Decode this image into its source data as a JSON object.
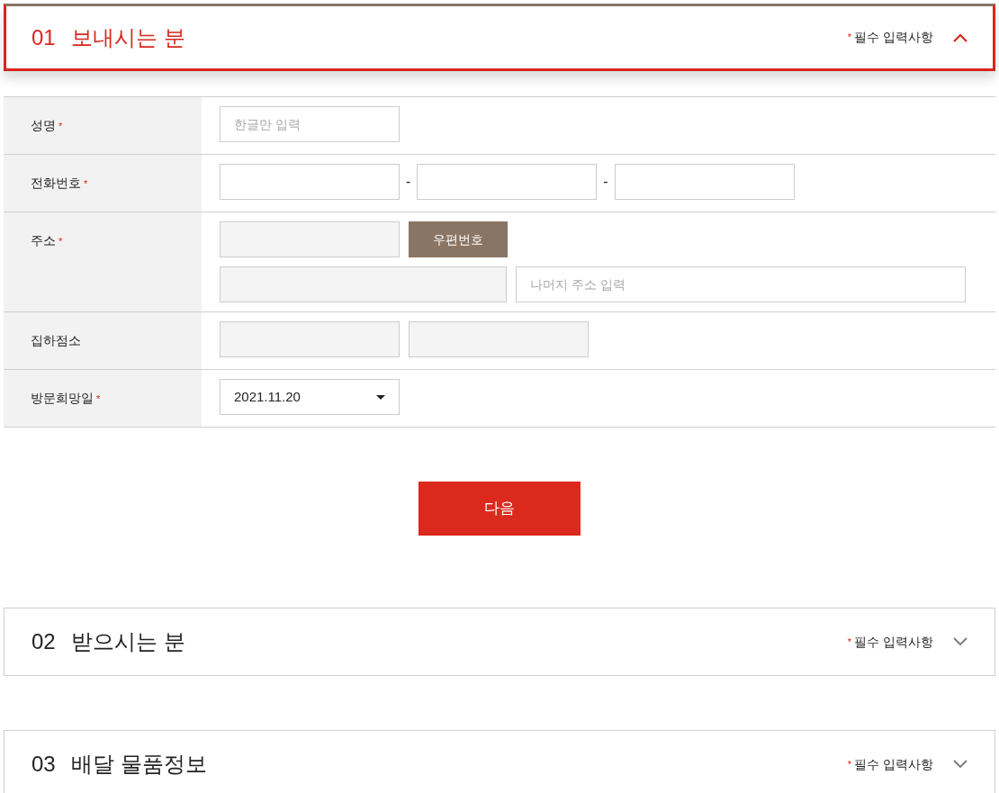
{
  "sections": [
    {
      "number": "01",
      "title": "보내시는 분",
      "required_mark": "*",
      "required_note": "필수 입력사항",
      "expanded": true,
      "form": {
        "rows": [
          {
            "label": "성명",
            "required_mark": "*",
            "lines": [
              [
                {
                  "kind": "input",
                  "placeholder": "한글만 입력"
                }
              ]
            ]
          },
          {
            "label": "전화번호",
            "required_mark": "*",
            "lines": [
              [
                {
                  "kind": "input"
                },
                {
                  "kind": "separator",
                  "text": "-"
                },
                {
                  "kind": "input"
                },
                {
                  "kind": "separator",
                  "text": "-"
                },
                {
                  "kind": "input"
                }
              ]
            ]
          },
          {
            "label": "주소",
            "required_mark": "*",
            "lines": [
              [
                {
                  "kind": "readonly"
                },
                {
                  "kind": "button",
                  "label": "우편번호"
                }
              ],
              [
                {
                  "kind": "readonly-wide"
                },
                {
                  "kind": "input-wide",
                  "placeholder": "나머지 주소 입력"
                }
              ]
            ]
          },
          {
            "label": "집하점소",
            "lines": [
              [
                {
                  "kind": "readonly"
                },
                {
                  "kind": "readonly"
                }
              ]
            ]
          },
          {
            "label": "방문희망일",
            "required_mark": "*",
            "lines": [
              [
                {
                  "kind": "select",
                  "value": "2021.11.20"
                }
              ]
            ]
          }
        ],
        "submit": "다음"
      }
    },
    {
      "number": "02",
      "title": "받으시는 분",
      "required_mark": "*",
      "required_note": "필수 입력사항",
      "expanded": false
    },
    {
      "number": "03",
      "title": "배달 물품정보",
      "required_mark": "*",
      "required_note": "필수 입력사항",
      "expanded": false
    }
  ]
}
